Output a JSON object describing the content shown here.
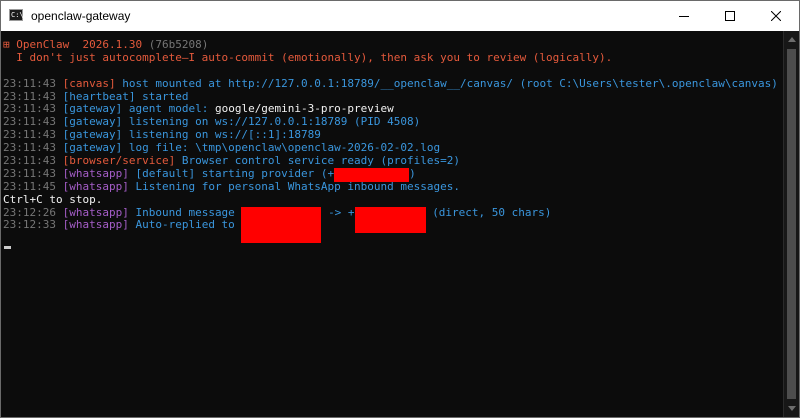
{
  "window": {
    "title": "openclaw-gateway",
    "app_icon_text": "C:\\"
  },
  "colors": {
    "orange": "#e55a3c",
    "timestamp": "#767676",
    "message": "#3a96dd",
    "whatsapp_tag": "#a55ec8",
    "redaction": "#ff0000",
    "background": "#0c0c0c"
  },
  "banner": {
    "logo_glyph": "⊞",
    "name": "OpenClaw",
    "version": "2026.1.30",
    "commit": "(76b5208)",
    "tagline": "I don't just autocomplete—I auto-commit (emotionally), then ask you to review (logically)."
  },
  "log": [
    {
      "time": "23:11:43",
      "tag": "[canvas]",
      "pre": "host mounted at http://127.0.0.1:18789/__openclaw__/canvas/ (root C:\\Users\\tester\\.openclaw\\canvas)"
    },
    {
      "time": "23:11:43",
      "tag": "[heartbeat]",
      "pre": "started"
    },
    {
      "time": "23:11:43",
      "tag": "[gateway]",
      "pre": "agent model:",
      "highlight": "google/gemini-3-pro-preview"
    },
    {
      "time": "23:11:43",
      "tag": "[gateway]",
      "pre": "listening on ws://127.0.0.1:18789 (PID 4508)"
    },
    {
      "time": "23:11:43",
      "tag": "[gateway]",
      "pre": "listening on ws://[::1]:18789"
    },
    {
      "time": "23:11:43",
      "tag": "[gateway]",
      "pre": "log file: \\tmp\\openclaw\\openclaw-2026-02-02.log"
    },
    {
      "time": "23:11:43",
      "tag": "[browser/service]",
      "pre": "Browser control service ready (profiles=2)"
    },
    {
      "time": "23:11:43",
      "tag": "[whatsapp]",
      "pre": "[default] starting provider (+",
      "post": ")"
    },
    {
      "time": "23:11:45",
      "tag": "[whatsapp]",
      "pre": "Listening for personal WhatsApp inbound messages."
    },
    {
      "plain": "Ctrl+C to stop."
    },
    {
      "time": "23:12:26",
      "tag": "[whatsapp]",
      "pre": "Inbound message",
      "mid": "-> +",
      "post": "(direct, 50 chars)"
    },
    {
      "time": "23:12:33",
      "tag": "[whatsapp]",
      "pre": "Auto-replied to"
    }
  ]
}
